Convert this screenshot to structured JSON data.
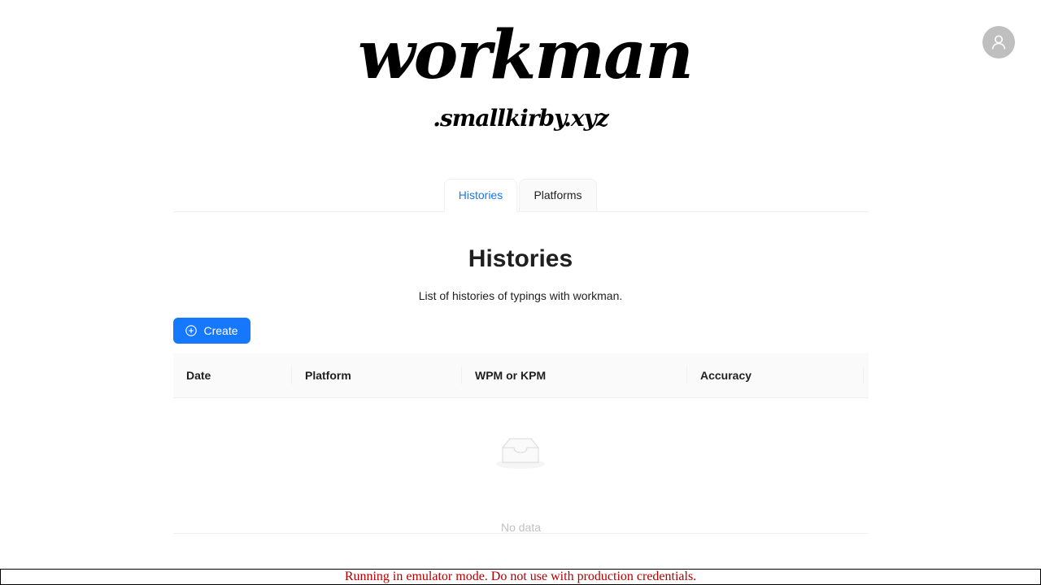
{
  "logo": {
    "main": "workman",
    "sub": ".smallkirby.xyz"
  },
  "user": {
    "icon": "user-icon"
  },
  "tabs": [
    {
      "label": "Histories",
      "active": true
    },
    {
      "label": "Platforms",
      "active": false
    }
  ],
  "page": {
    "title": "Histories",
    "description": "List of histories of typings with workman."
  },
  "create_button": {
    "label": "Create",
    "icon": "plus-circle-icon"
  },
  "table": {
    "columns": [
      "Date",
      "Platform",
      "WPM or KPM",
      "Accuracy"
    ],
    "rows": [],
    "empty_text": "No data",
    "empty_icon": "empty-inbox-icon"
  },
  "banner": {
    "text": "Running in emulator mode. Do not use with production credentials."
  },
  "colors": {
    "primary": "#1677ff",
    "banner_text": "#b00000"
  }
}
